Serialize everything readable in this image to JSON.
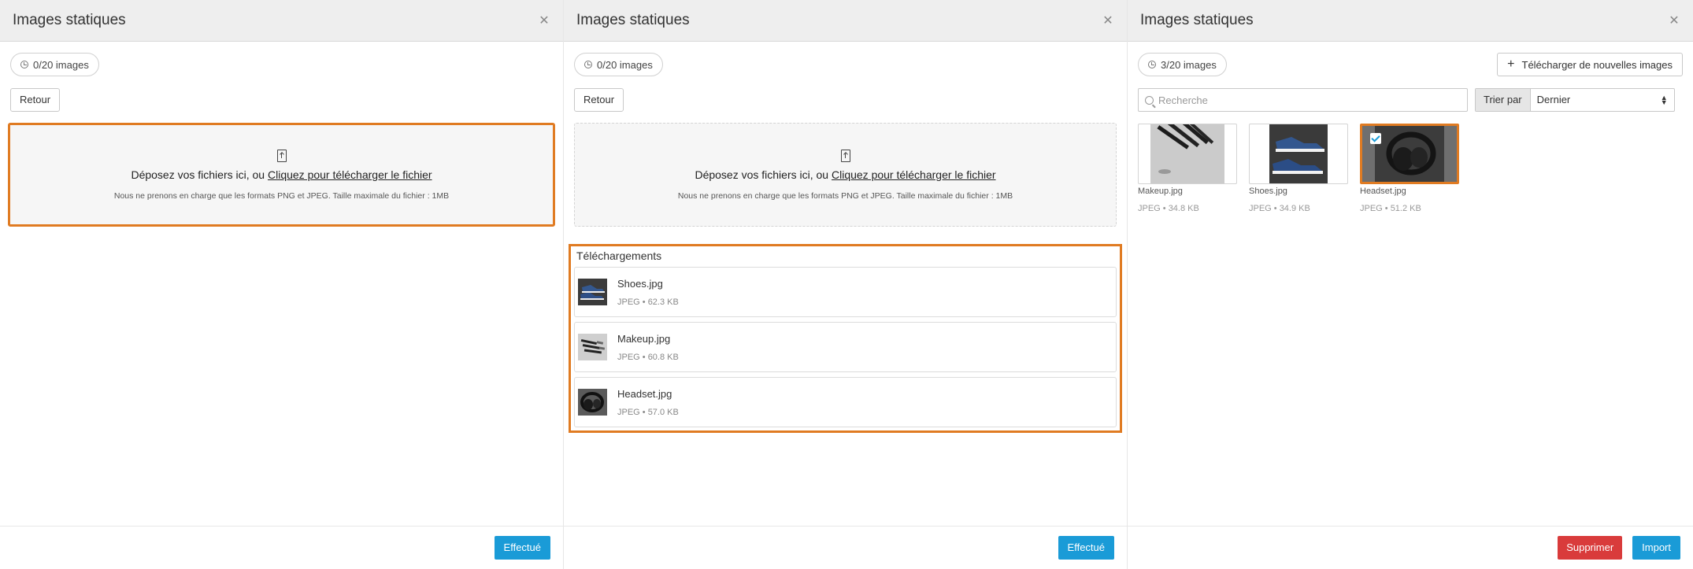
{
  "panels": [
    {
      "title": "Images statiques",
      "count": "0/20 images",
      "back_label": "Retour",
      "drop_text": "Déposez vos fichiers ici, ou ",
      "drop_link": "Cliquez pour télécharger le fichier",
      "drop_note": "Nous ne prenons en charge que les formats PNG et JPEG. Taille maximale du fichier : 1MB",
      "done_label": "Effectué"
    },
    {
      "title": "Images statiques",
      "count": "0/20 images",
      "back_label": "Retour",
      "drop_text": "Déposez vos fichiers ici, ou ",
      "drop_link": "Cliquez pour télécharger le fichier",
      "drop_note": "Nous ne prenons en charge que les formats PNG et JPEG. Taille maximale du fichier : 1MB",
      "uploads_title": "Téléchargements",
      "uploads": [
        {
          "name": "Shoes.jpg",
          "info": "JPEG • 62.3 KB",
          "icon": "shoes-thumbnail"
        },
        {
          "name": "Makeup.jpg",
          "info": "JPEG • 60.8 KB",
          "icon": "makeup-thumbnail"
        },
        {
          "name": "Headset.jpg",
          "info": "JPEG • 57.0 KB",
          "icon": "headset-thumbnail"
        }
      ],
      "done_label": "Effectué"
    },
    {
      "title": "Images statiques",
      "count": "3/20 images",
      "upload_new_label": "Télécharger de nouvelles images",
      "search_placeholder": "Recherche",
      "sort_label": "Trier par",
      "sort_value": "Dernier",
      "images": [
        {
          "name": "Makeup.jpg",
          "info": "JPEG • 34.8 KB",
          "selected": false
        },
        {
          "name": "Shoes.jpg",
          "info": "JPEG • 34.9 KB",
          "selected": false
        },
        {
          "name": "Headset.jpg",
          "info": "JPEG • 51.2 KB",
          "selected": true
        }
      ],
      "delete_label": "Supprimer",
      "import_label": "Import"
    }
  ],
  "colors": {
    "accent": "#1a9bd7",
    "danger": "#d93b3b",
    "highlight": "#e07b22"
  }
}
